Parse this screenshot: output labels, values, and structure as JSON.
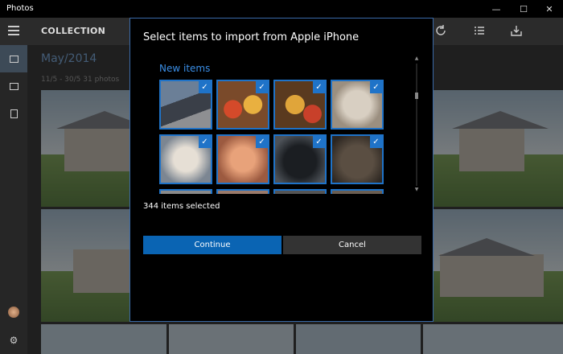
{
  "window": {
    "title": "Photos",
    "minimize": "—",
    "maximize": "☐",
    "close": "✕"
  },
  "app": {
    "section_title": "COLLECTION"
  },
  "collection": {
    "month": "May/2014",
    "range": "11/5 - 30/5   31 photos"
  },
  "dialog": {
    "title": "Select items to import from Apple iPhone",
    "group_label": "New items",
    "selected_count": "344 items selected",
    "continue_label": "Continue",
    "cancel_label": "Cancel",
    "check_glyph": "✓"
  },
  "colors": {
    "accent": "#1f73c8",
    "primary_button": "#0a64b3",
    "group_label": "#3a8ee6"
  },
  "icons": [
    "hamburger-icon",
    "refresh-icon",
    "select-icon",
    "import-icon",
    "photos-icon",
    "albums-icon",
    "folders-icon",
    "avatar",
    "settings-icon"
  ]
}
